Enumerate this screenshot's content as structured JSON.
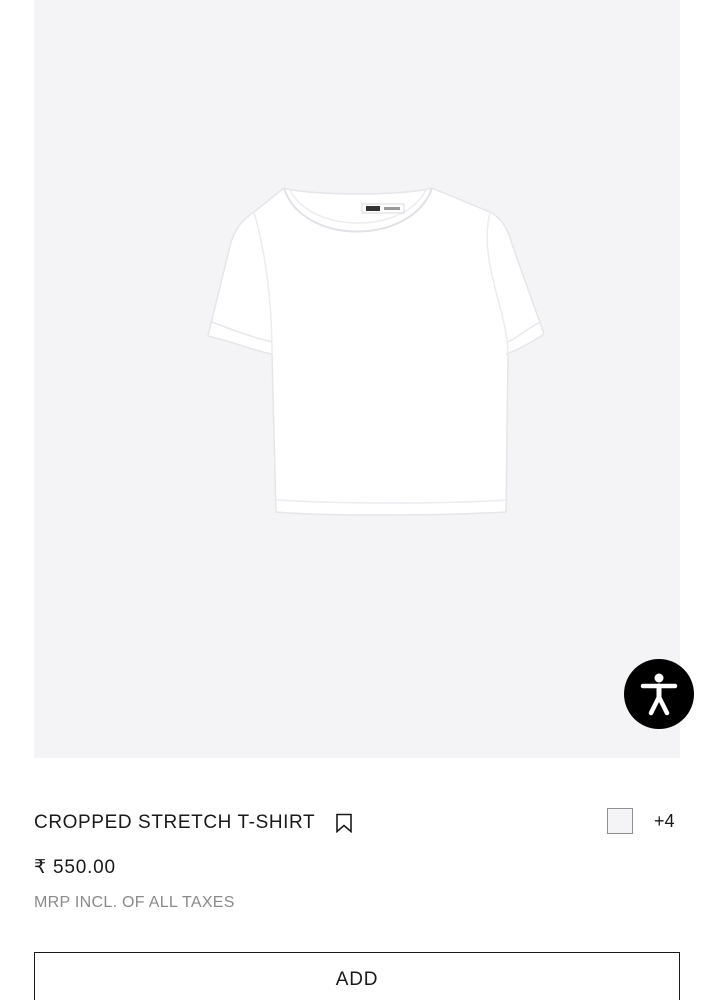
{
  "product": {
    "image_alt_icon": "white-cropped-tshirt",
    "title": "CROPPED STRETCH T-SHIRT",
    "price": "₹ 550.00",
    "tax_note": "MRP INCL. OF ALL TAXES",
    "more_colors": "+4",
    "selected_color": "#f4f3f6"
  },
  "actions": {
    "add_label": "ADD"
  },
  "icons": {
    "bookmark": "bookmark-icon",
    "accessibility": "accessibility-icon"
  },
  "colors": {
    "image_background": "#f4f3f6",
    "accent": "#000000",
    "muted_text": "#8a8a8a"
  }
}
